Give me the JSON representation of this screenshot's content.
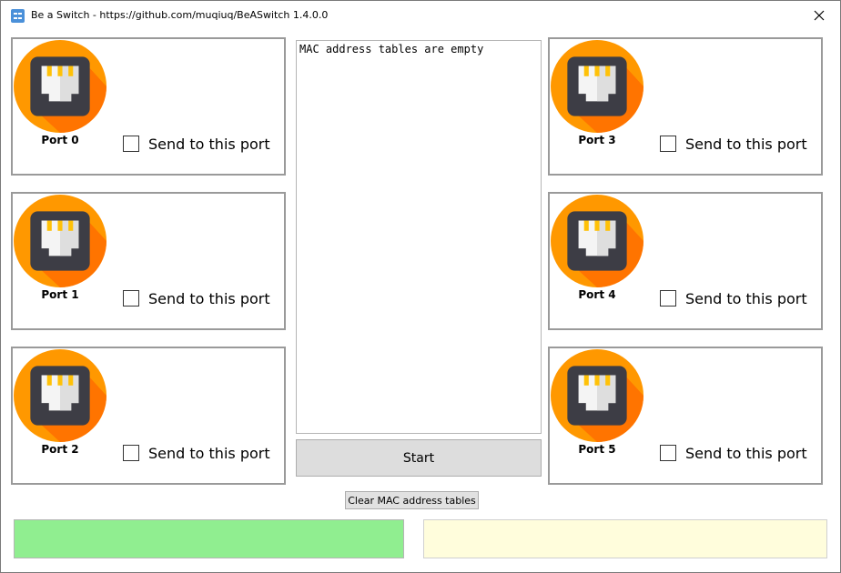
{
  "window": {
    "title": "Be a Switch - https://github.com/muqiuq/BeASwitch 1.4.0.0",
    "close_glyph": "✕"
  },
  "ports": [
    {
      "label": "Port 0",
      "send_label": "Send to this port",
      "checked": false
    },
    {
      "label": "Port 1",
      "send_label": "Send to this port",
      "checked": false
    },
    {
      "label": "Port 2",
      "send_label": "Send to this port",
      "checked": false
    },
    {
      "label": "Port 3",
      "send_label": "Send to this port",
      "checked": false
    },
    {
      "label": "Port 4",
      "send_label": "Send to this port",
      "checked": false
    },
    {
      "label": "Port 5",
      "send_label": "Send to this port",
      "checked": false
    }
  ],
  "mac_table": {
    "text": "MAC address tables are empty"
  },
  "buttons": {
    "start": "Start",
    "clear": "Clear MAC address tables"
  },
  "status": {
    "left_color": "#90ee90",
    "right_color": "#fffddc"
  },
  "colors": {
    "icon_orange": "#ff9800",
    "icon_orange_dark": "#ff6d00",
    "icon_plug_dark": "#3d3d45",
    "icon_plug_light": "#f4f4f4",
    "icon_pins": "#ffc107"
  }
}
